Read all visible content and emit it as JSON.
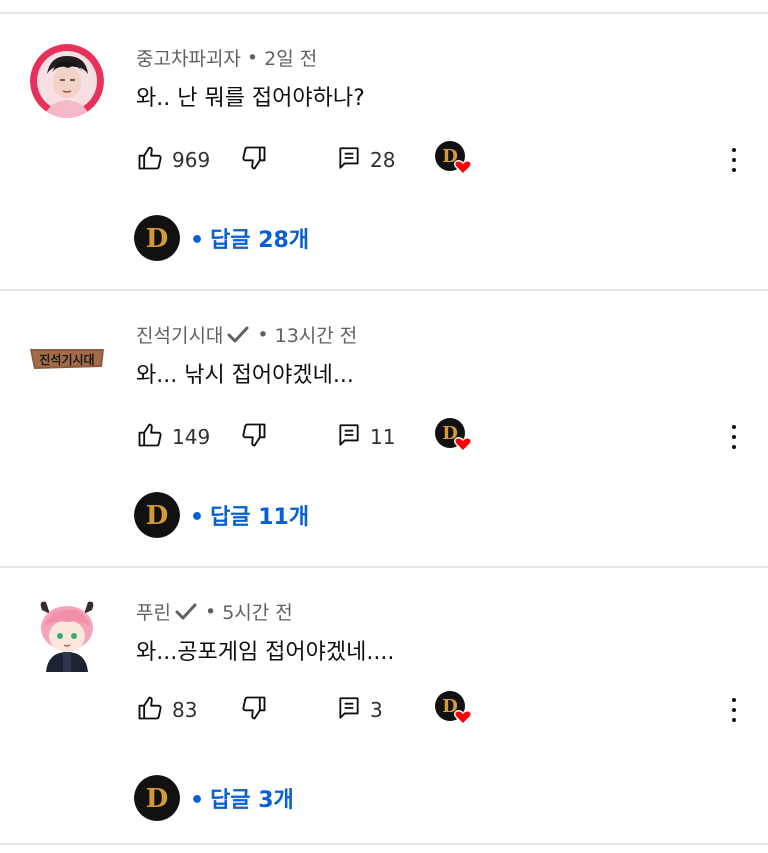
{
  "comments": [
    {
      "author": "중고차파괴자",
      "verified": false,
      "time": "2일 전",
      "text": "와.. 난 뭐를 접어야하나?",
      "likes": "969",
      "reply_count": "28",
      "replies_label": "답글 28개"
    },
    {
      "author": "진석기시대",
      "verified": true,
      "time": "13시간 전",
      "text": "와... 낚시 접어야겠네...",
      "likes": "149",
      "reply_count": "11",
      "replies_label": "답글 11개"
    },
    {
      "author": "푸린",
      "verified": true,
      "time": "5시간 전",
      "text": "와...공포게임 접어야겠네....",
      "likes": "83",
      "reply_count": "3",
      "replies_label": "답글 3개"
    }
  ],
  "avatar_logo_text": "진석기시대",
  "creator_logo_letter": "D",
  "colors": {
    "link": "#065fd4",
    "meta": "#606060",
    "heart": "#ff0000",
    "divider": "#e6e6e6"
  },
  "icons": [
    "thumbs-up-icon",
    "thumbs-down-icon",
    "reply-icon",
    "creator-heart-icon",
    "more-vert-icon",
    "verified-check-icon"
  ]
}
